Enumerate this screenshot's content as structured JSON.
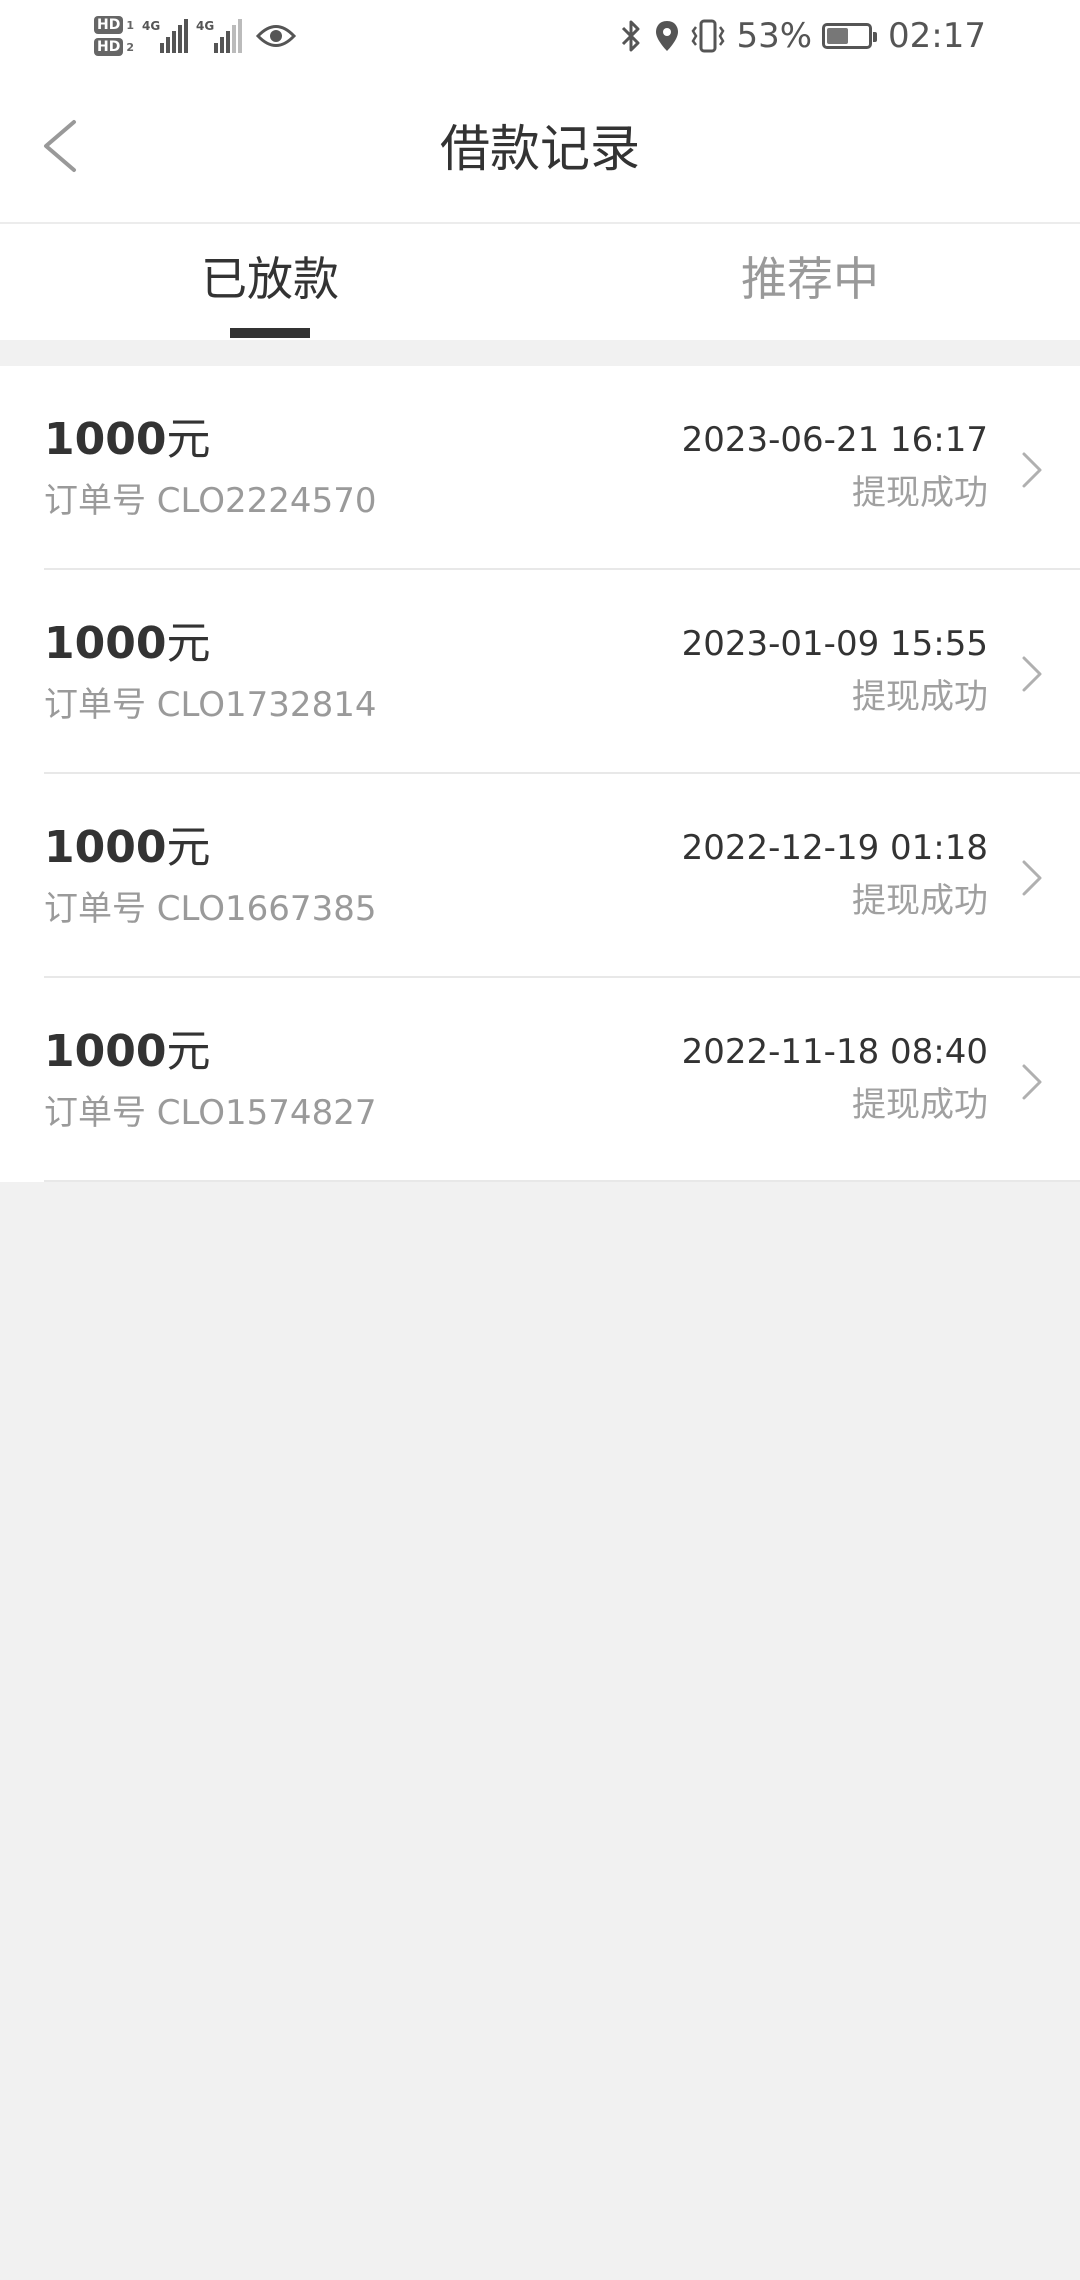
{
  "status_bar": {
    "hd1": "HD",
    "hd1_sub": "1",
    "hd2": "HD",
    "hd2_sub": "2",
    "signal1_label": "4G",
    "signal2_label": "4G",
    "battery_text": "53%",
    "battery_level": 0.53,
    "time": "02:17",
    "icons": [
      "bluetooth-icon",
      "location-icon",
      "vibrate-icon",
      "battery-icon",
      "eye-icon"
    ]
  },
  "header": {
    "title": "借款记录",
    "back_icon": "chevron-left-icon"
  },
  "tabs": [
    {
      "label": "已放款",
      "active": true
    },
    {
      "label": "推荐中",
      "active": false
    }
  ],
  "records": [
    {
      "amount": "1000",
      "unit": "元",
      "order": "订单号 CLO2224570",
      "datetime": "2023-06-21 16:17",
      "status": "提现成功"
    },
    {
      "amount": "1000",
      "unit": "元",
      "order": "订单号 CLO1732814",
      "datetime": "2023-01-09 15:55",
      "status": "提现成功"
    },
    {
      "amount": "1000",
      "unit": "元",
      "order": "订单号 CLO1667385",
      "datetime": "2022-12-19 01:18",
      "status": "提现成功"
    },
    {
      "amount": "1000",
      "unit": "元",
      "order": "订单号 CLO1574827",
      "datetime": "2022-11-18 08:40",
      "status": "提现成功"
    }
  ],
  "colors": {
    "background": "#f1f1f1",
    "card": "#ffffff",
    "primary_text": "#333333",
    "secondary_text": "#9a9a9a",
    "indicator": "#333333"
  }
}
